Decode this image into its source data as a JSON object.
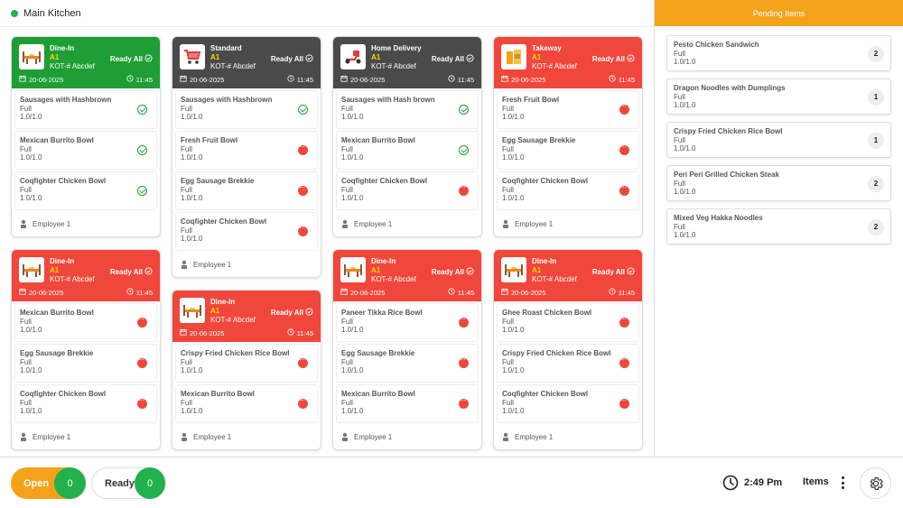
{
  "header": {
    "location": "Main Kitchen"
  },
  "columns": [
    {
      "orders": [
        {
          "head_color": "green",
          "type": "Dine-In",
          "table": "A1",
          "kot": "KOT-# Abcdef",
          "ready_label": "Ready All",
          "date": "20-06-2025",
          "time": "11:45",
          "icon": "dine-in-icon",
          "items": [
            {
              "name": "Sausages with Hashbrown",
              "portion": "Full",
              "qty": "1.0/1.0",
              "status": "done"
            },
            {
              "name": "Mexican Burrito Bowl",
              "portion": "Full",
              "qty": "1.0/1.0",
              "status": "done"
            },
            {
              "name": "Coqfighter Chicken Bowl",
              "portion": "Full",
              "qty": "1.0/1.0",
              "status": "done"
            }
          ],
          "employee": "Employee 1"
        },
        {
          "head_color": "red",
          "type": "Dine-In",
          "table": "A1",
          "kot": "KOT-# Abcdef",
          "ready_label": "Ready All",
          "date": "20-06-2025",
          "time": "11:45",
          "icon": "dine-in-icon",
          "items": [
            {
              "name": "Mexican Burrito Bowl",
              "portion": "Full",
              "qty": "1.0/1.0",
              "status": "pending"
            },
            {
              "name": "Egg Sausage Brekkie",
              "portion": "Full",
              "qty": "1.0/1.0",
              "status": "pending"
            },
            {
              "name": "Coqfighter Chicken Bowl",
              "portion": "Full",
              "qty": "1.0/1.0",
              "status": "pending"
            }
          ],
          "employee": "Employee 1"
        }
      ]
    },
    {
      "orders": [
        {
          "head_color": "dark",
          "type": "Standard",
          "table": "A1",
          "kot": "KOT-# Abcdef",
          "ready_label": "Ready All",
          "date": "20-06-2025",
          "time": "11:45",
          "icon": "cart-icon",
          "items": [
            {
              "name": "Sausages with Hashbrown",
              "portion": "Full",
              "qty": "1.0/1.0",
              "status": "done"
            },
            {
              "name": "Fresh Fruit Bowl",
              "portion": "Full",
              "qty": "1.0/1.0",
              "status": "pending"
            },
            {
              "name": "Egg Sausage Brekkie",
              "portion": "Full",
              "qty": "1.0/1.0",
              "status": "pending"
            },
            {
              "name": "Coqfighter Chicken Bowl",
              "portion": "Full",
              "qty": "1.0/1.0",
              "status": "pending"
            }
          ],
          "employee": "Employee 1"
        },
        {
          "head_color": "red",
          "type": "Dine-In",
          "table": "A1",
          "kot": "KOT-# Abcdef",
          "ready_label": "Ready All",
          "date": "20-06-2025",
          "time": "11:45",
          "icon": "dine-in-icon",
          "items": [
            {
              "name": "Crispy Fried Chicken Rice Bowl",
              "portion": "Full",
              "qty": "1.0/1.0",
              "status": "pending"
            },
            {
              "name": "Mexican Burrito Bowl",
              "portion": "Full",
              "qty": "1.0/1.0",
              "status": "pending"
            }
          ],
          "employee": "Employee 1"
        }
      ]
    },
    {
      "orders": [
        {
          "head_color": "dark",
          "type": "Home Delivery",
          "table": "A1",
          "kot": "KOT-# Abcdef",
          "ready_label": "Ready All",
          "date": "20-06-2025",
          "time": "11:45",
          "icon": "scooter-icon",
          "items": [
            {
              "name": "Sausages with Hash brown",
              "portion": "Full",
              "qty": "1.0/1.0",
              "status": "done"
            },
            {
              "name": "Mexican Burrito Bowl",
              "portion": "Full",
              "qty": "1.0/1.0",
              "status": "done"
            },
            {
              "name": "Coqfighter Chicken Bowl",
              "portion": "Full",
              "qty": "1.0/1.0",
              "status": "pending"
            }
          ],
          "employee": "Employee 1"
        },
        {
          "head_color": "red",
          "type": "Dine-In",
          "table": "A1",
          "kot": "KOT-# Abcdef",
          "ready_label": "Ready All",
          "date": "20-06-2025",
          "time": "11:45",
          "icon": "dine-in-icon",
          "items": [
            {
              "name": "Paneer Tikka Rice Bowl",
              "portion": "Full",
              "qty": "1.0/1.0",
              "status": "pending"
            },
            {
              "name": "Egg Sausage Brekkie",
              "portion": "Full",
              "qty": "1.0/1.0",
              "status": "pending"
            },
            {
              "name": "Mexican Burrito Bowl",
              "portion": "Full",
              "qty": "1.0/1.0",
              "status": "pending"
            }
          ],
          "employee": "Employee 1"
        }
      ]
    },
    {
      "orders": [
        {
          "head_color": "red",
          "type": "Takeway",
          "table": "A1",
          "kot": "KOT-# Abcdef",
          "ready_label": "Ready All",
          "date": "20-06-2025",
          "time": "11:45",
          "icon": "takeaway-cup-icon",
          "items": [
            {
              "name": "Fresh Fruit Bowl",
              "portion": "Full",
              "qty": "1.0/1.0",
              "status": "pending"
            },
            {
              "name": "Egg Sausage Brekkie",
              "portion": "Full",
              "qty": "1.0/1.0",
              "status": "pending"
            },
            {
              "name": "Coqfighter Chicken Bowl",
              "portion": "Full",
              "qty": "1.0/1.0",
              "status": "pending"
            }
          ],
          "employee": "Employee 1"
        },
        {
          "head_color": "red",
          "type": "Dine-In",
          "table": "A1",
          "kot": "KOT-# Abcdef",
          "ready_label": "Ready All",
          "date": "20-06-2025",
          "time": "11:45",
          "icon": "dine-in-icon",
          "items": [
            {
              "name": "Ghee Roast Chicken Bowl",
              "portion": "Full",
              "qty": "1.0/1.0",
              "status": "pending"
            },
            {
              "name": "Crispy Fried Chicken Rice Bowl",
              "portion": "Full",
              "qty": "1.0/1.0",
              "status": "pending"
            },
            {
              "name": "Coqfighter Chicken Bowl",
              "portion": "Full",
              "qty": "1.0/1.0",
              "status": "pending"
            }
          ],
          "employee": "Employee 1"
        }
      ]
    }
  ],
  "pending": {
    "title": "Pending Items",
    "items": [
      {
        "name": "Pesto Chicken Sandwich",
        "portion": "Full",
        "qty": "1.0/1.0",
        "count": "2"
      },
      {
        "name": "Dragon Noodles with Dumplings",
        "portion": "Full",
        "qty": "1.0/1.0",
        "count": "1"
      },
      {
        "name": "Crispy Fried Chicken Rice Bowl",
        "portion": "Full",
        "qty": "1.0/1.0",
        "count": "1"
      },
      {
        "name": "Peri Peri Grilled Chicken Steak",
        "portion": "Full",
        "qty": "1.0/1.0",
        "count": "2"
      },
      {
        "name": "Mixed Veg Hakka Noodles",
        "portion": "Full",
        "qty": "1.0/1.0",
        "count": "2"
      }
    ]
  },
  "bottom": {
    "open_label": "Open",
    "open_count": "0",
    "ready_label": "Ready",
    "ready_count": "0",
    "time": "2:49 Pm",
    "items_label": "Items"
  },
  "colors": {
    "accent": "#f5a21b",
    "green": "#1e9e35",
    "red": "#f0473c",
    "dark": "#4a4a4a"
  }
}
